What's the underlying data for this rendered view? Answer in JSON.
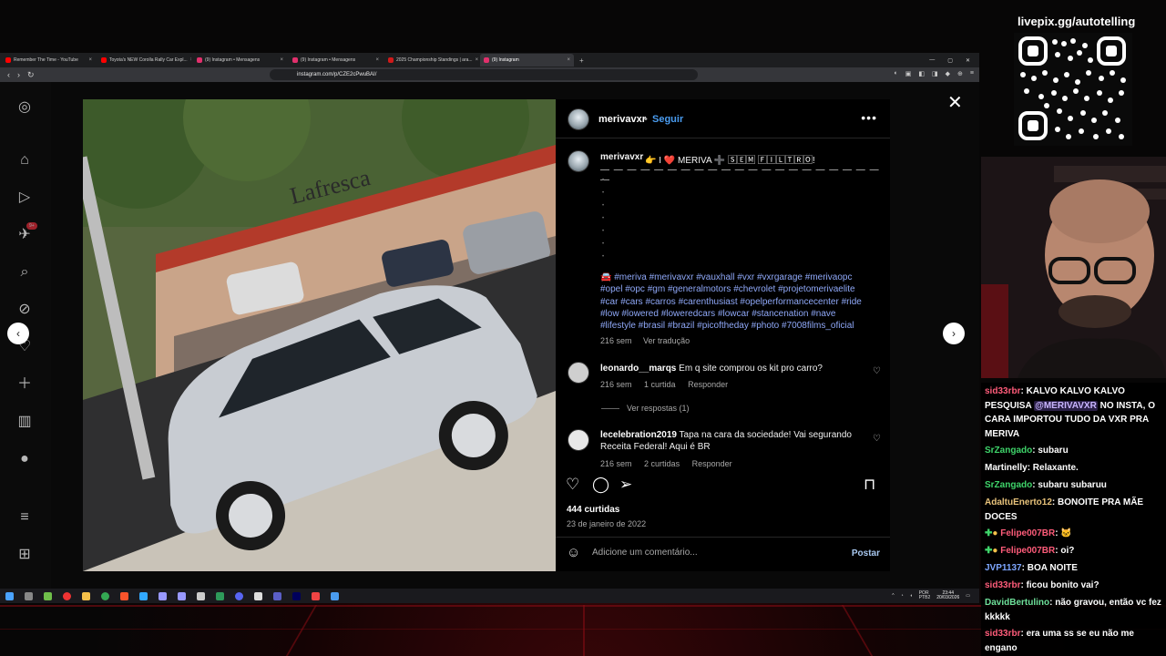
{
  "browser": {
    "tabs": [
      {
        "label": "Remember The Time - YouTube",
        "color": "#ff0000",
        "active": false
      },
      {
        "label": "Toyota's NEW Corolla Rally Car Expl...",
        "color": "#ff0000",
        "active": false
      },
      {
        "label": "(9) Instagram • Mensagens",
        "color": "#e1306c",
        "active": false
      },
      {
        "label": "(9) Instagram • Mensagens",
        "color": "#e1306c",
        "active": false
      },
      {
        "label": "2025 Championship Standings | ara...",
        "color": "#d01a1a",
        "active": false
      },
      {
        "label": "(9) Instagram",
        "color": "#e1306c",
        "active": true
      }
    ],
    "url": "instagram.com/p/CZE2cPwuBAI/"
  },
  "post": {
    "username": "merivavxr",
    "follow_label": "Seguir",
    "caption_line": "👉 I ❤️ MERIVA ➕ 🅂🄴🄼 🄵🄸🄻🅃🅁🄾!",
    "caption_dashes": "— — — — — — — — — — — — — — — — — — — — — —",
    "hashtags": "🚘 #meriva #merivavxr #vauxhall #vxr #vxrgarage #merivaopc #opel #opc #gm #generalmotors #chevrolet #projetomerivaelite #car #cars #carros #carenthusiast #opelperformancecenter #ride #low #lowered #loweredcars #lowcar #stancenation #nave #lifestyle #brasil #brazil #picoftheday #photo #7008films_oficial",
    "caption_time": "216 sem",
    "translate_label": "Ver tradução",
    "likes": "444 curtidas",
    "date": "23 de janeiro de 2022",
    "comment_placeholder": "Adicione um comentário...",
    "post_button": "Postar"
  },
  "comments": [
    {
      "user": "leonardo__marqs",
      "text": "Em q site comprou os kit pro carro?",
      "time": "216 sem",
      "likes": "1 curtida",
      "reply": "Responder"
    },
    {
      "user": "lecelebration2019",
      "text": "Tapa na cara da sociedade! Vai segurando Receita Federal! Aqui é BR",
      "time": "216 sem",
      "likes": "2 curtidas",
      "reply": "Responder"
    }
  ],
  "view_replies": "Ver respostas (1)",
  "taskbar": {
    "lang": "POR\nPTB2",
    "time": "23:44",
    "date": "20/03/2026"
  },
  "stream": {
    "livepix": "livepix.gg/autotelling",
    "chat": [
      {
        "name": "sid33rbr",
        "color": "#ff5c7a",
        "text": ": KALVO KALVO KALVO PESQUISA ",
        "mention": "@MERIVAVXR",
        "text2": " NO INSTA, O CARA IMPORTOU TUDO DA VXR PRA MERIVA"
      },
      {
        "name": "SrZangado",
        "color": "#3fd46a",
        "text": ": subaru"
      },
      {
        "name": "Martinelly",
        "color": "#ffffff",
        "text": ": Relaxante."
      },
      {
        "name": "SrZangado",
        "color": "#3fd46a",
        "text": ": subaru subaruu"
      },
      {
        "name": "AdaltuEnerto12",
        "color": "#e8c27a",
        "text": ": BONOITE PRA MÃE DOCES"
      },
      {
        "name": "Felipe007BR",
        "color": "#ff5c7a",
        "text": ": 🐱"
      },
      {
        "name": "Felipe007BR",
        "color": "#ff5c7a",
        "text": ": oi?"
      },
      {
        "name": "JVP1137",
        "color": "#7ea6ff",
        "text": ": BOA NOITE"
      },
      {
        "name": "sid33rbr",
        "color": "#ff5c7a",
        "text": ": ficou bonito vai?"
      },
      {
        "name": "DavidBertulino",
        "color": "#6fe09a",
        "text": ": não gravou, então vc fez kkkkk"
      },
      {
        "name": "sid33rbr",
        "color": "#ff5c7a",
        "text": ": era uma ss se eu não me engano"
      }
    ]
  }
}
